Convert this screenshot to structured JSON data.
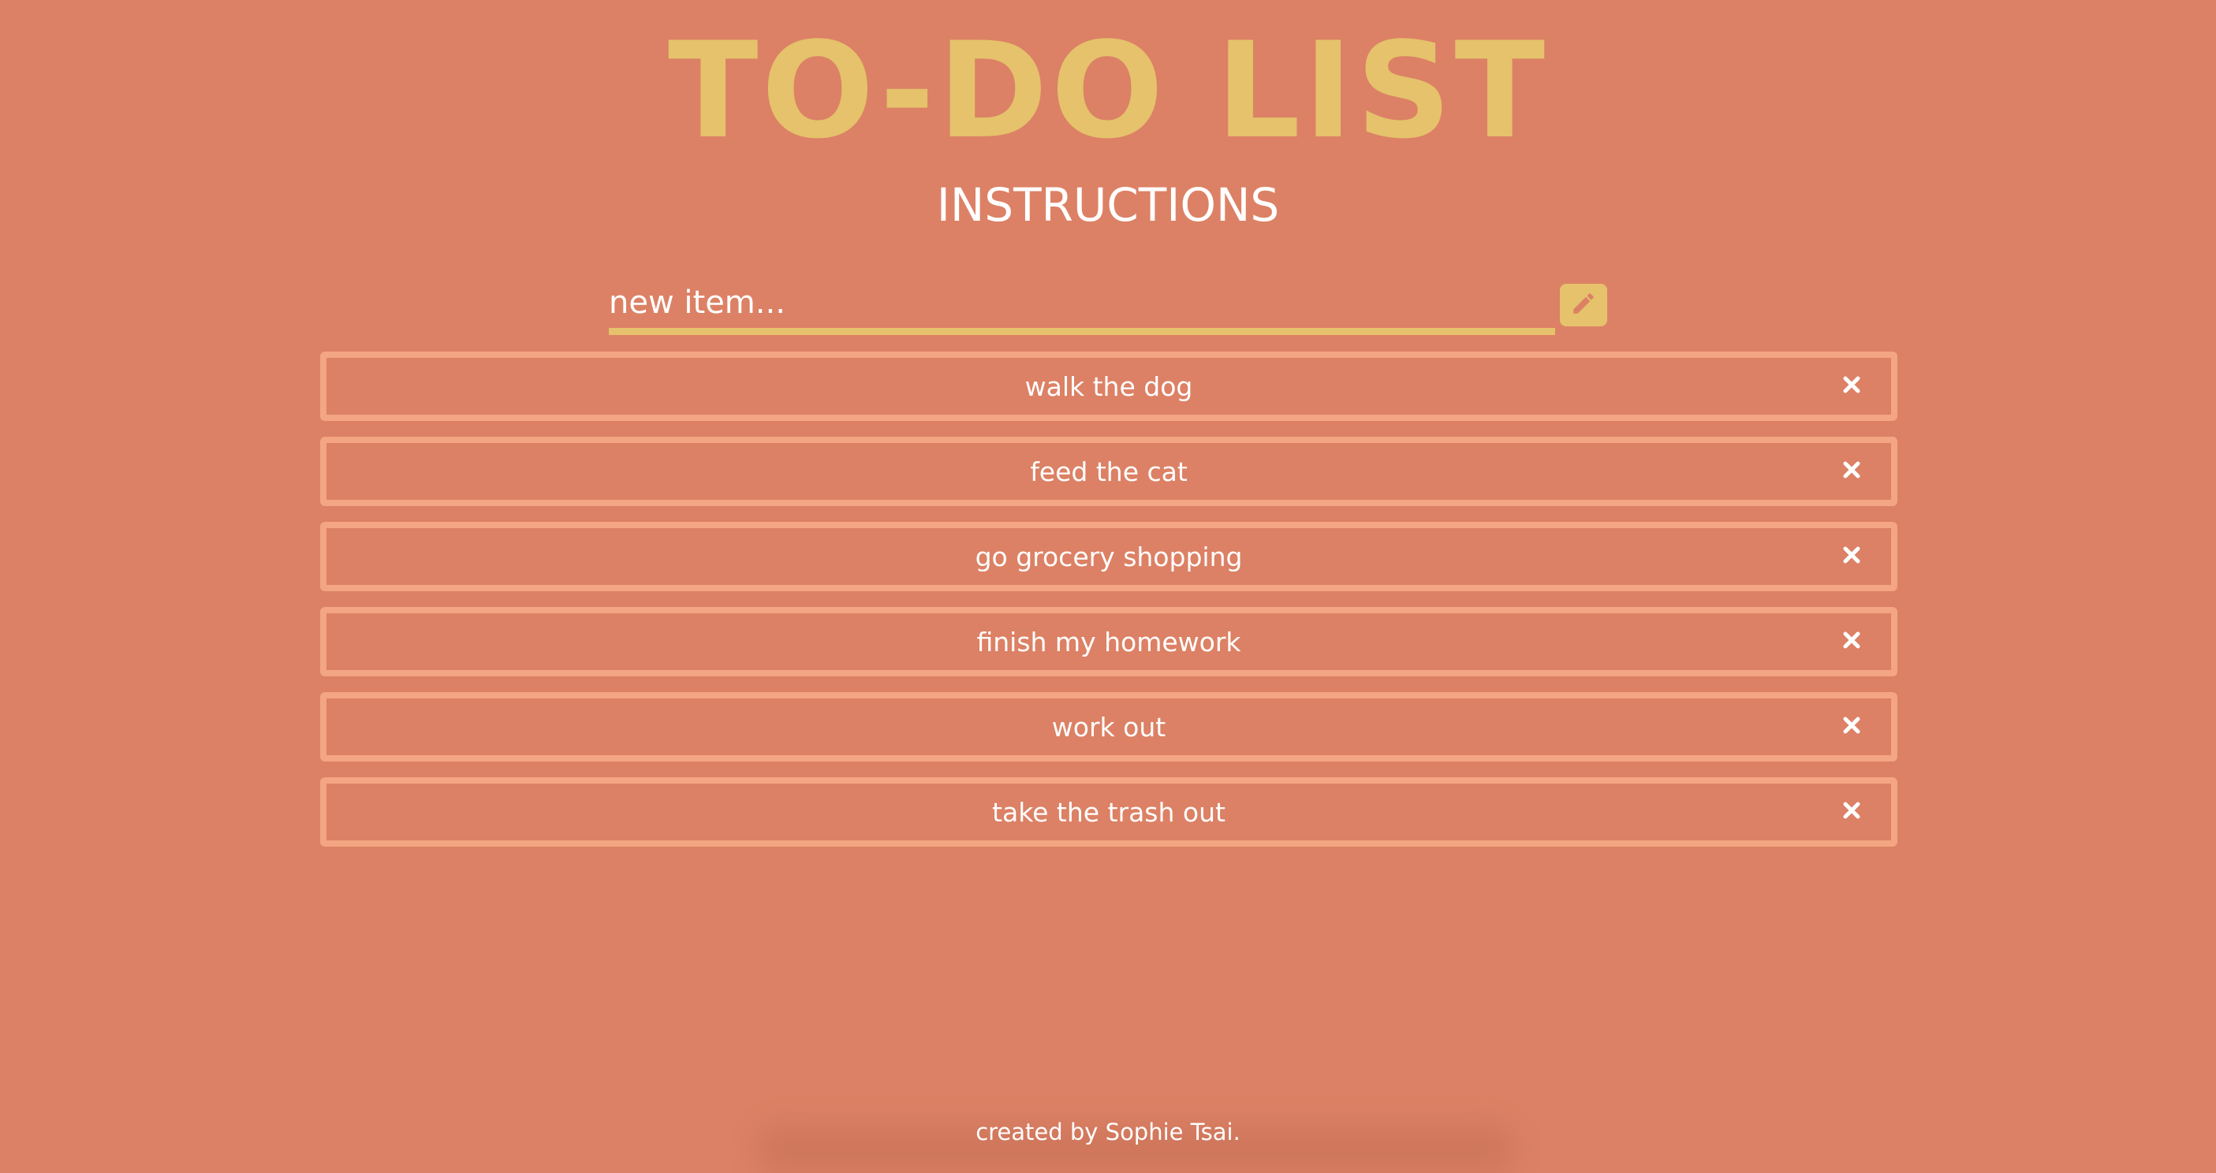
{
  "header": {
    "title": "TO-DO LIST",
    "instructions_label": "INSTRUCTIONS"
  },
  "new_item": {
    "placeholder": "new item...",
    "value": "",
    "add_icon": "pencil-icon"
  },
  "todos": [
    {
      "label": "walk the dog",
      "delete_icon": "close-icon"
    },
    {
      "label": "feed the cat",
      "delete_icon": "close-icon"
    },
    {
      "label": "go grocery shopping",
      "delete_icon": "close-icon"
    },
    {
      "label": "finish my homework",
      "delete_icon": "close-icon"
    },
    {
      "label": "work out",
      "delete_icon": "close-icon"
    },
    {
      "label": "take the trash out",
      "delete_icon": "close-icon"
    }
  ],
  "footer": {
    "credit": "created by Sophie Tsai."
  },
  "colors": {
    "background": "#dc8165",
    "accent": "#e5c26b",
    "item_border": "#f4a583",
    "text": "#ffffff"
  }
}
